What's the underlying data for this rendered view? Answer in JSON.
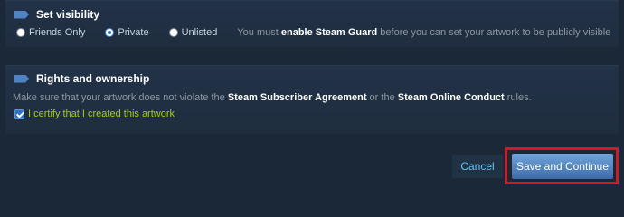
{
  "visibility": {
    "title": "Set visibility",
    "options": [
      {
        "label": "Friends Only",
        "checked": false
      },
      {
        "label": "Private",
        "checked": true
      },
      {
        "label": "Unlisted",
        "checked": false
      }
    ],
    "notice_prefix": "You must ",
    "notice_bold": "enable Steam Guard",
    "notice_suffix": " before you can set your artwork to be publicly visible"
  },
  "rights": {
    "title": "Rights and ownership",
    "text_prefix": "Make sure that your artwork does not violate the ",
    "link1": "Steam Subscriber Agreement",
    "text_middle": " or the ",
    "link2": "Steam Online Conduct",
    "text_suffix": " rules.",
    "certify_label": "I certify that I created this artwork",
    "certify_checked": true
  },
  "actions": {
    "cancel_label": "Cancel",
    "save_label": "Save and Continue"
  },
  "colors": {
    "background": "#1b2838",
    "accent": "#4f84c4",
    "highlight": "#d11a22",
    "certify_text": "#a4d007"
  }
}
